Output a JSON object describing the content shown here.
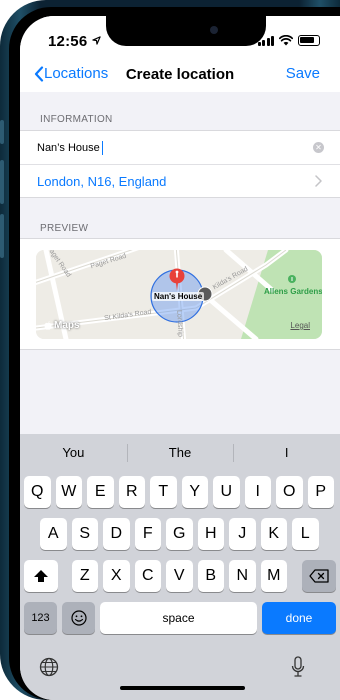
{
  "status": {
    "time": "12:56"
  },
  "nav": {
    "back_label": "Locations",
    "title": "Create location",
    "save_label": "Save"
  },
  "information": {
    "header": "INFORMATION",
    "name_value": "Nan’s House",
    "address": "London, N16, England"
  },
  "preview": {
    "header": "PREVIEW",
    "pin_label": "Nan's House",
    "park_label": "Allens Gardens",
    "maps_label": "Maps",
    "legal_label": "Legal",
    "streets": [
      "Paget Road",
      "St Kilda's Road",
      "St Kilda's Road",
      "Kilda's Road",
      "Lordship"
    ]
  },
  "keyboard": {
    "suggestions": [
      "You",
      "The",
      "I"
    ],
    "row1": [
      "Q",
      "W",
      "E",
      "R",
      "T",
      "Y",
      "U",
      "I",
      "O",
      "P"
    ],
    "row2": [
      "A",
      "S",
      "D",
      "F",
      "G",
      "H",
      "J",
      "K",
      "L"
    ],
    "row3": [
      "Z",
      "X",
      "C",
      "V",
      "B",
      "N",
      "M"
    ],
    "numbers_label": "123",
    "space_label": "space",
    "done_label": "done"
  },
  "colors": {
    "accent": "#0a7aff",
    "pin": "#e8413a",
    "park": "#2e9e48",
    "keyboard_bg": "#d1d3d9"
  }
}
